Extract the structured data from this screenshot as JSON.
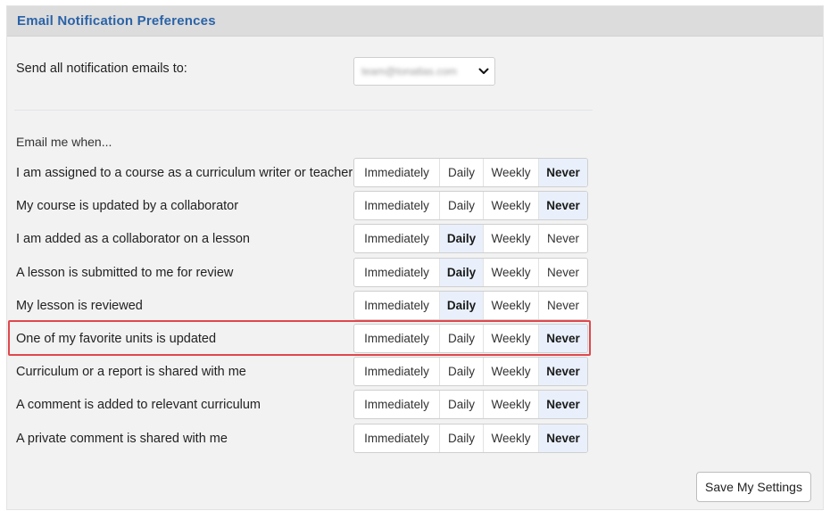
{
  "header": {
    "title": "Email Notification Preferences"
  },
  "send_to": {
    "label": "Send all notification emails to:",
    "value": "team@tonatlas.com"
  },
  "email_me_when": "Email me when...",
  "options": [
    "Immediately",
    "Daily",
    "Weekly",
    "Never"
  ],
  "rows": [
    {
      "label": "I am assigned to a course as a curriculum writer or teacher",
      "selected": "Never"
    },
    {
      "label": "My course is updated by a collaborator",
      "selected": "Never"
    },
    {
      "label": "I am added as a collaborator on a lesson",
      "selected": "Daily"
    },
    {
      "label": "A lesson is submitted to me for review",
      "selected": "Daily"
    },
    {
      "label": "My lesson is reviewed",
      "selected": "Daily"
    },
    {
      "label": "One of my favorite units is updated",
      "selected": "Never",
      "highlighted": true
    },
    {
      "label": "Curriculum or a report is shared with me",
      "selected": "Never"
    },
    {
      "label": "A comment is added to relevant curriculum",
      "selected": "Never"
    },
    {
      "label": "A private comment is shared with me",
      "selected": "Never"
    }
  ],
  "save_button": {
    "label": "Save My Settings"
  },
  "colors": {
    "title": "#2a63a8",
    "active_bg": "#e9f0fb",
    "highlight_border": "#e0474c"
  }
}
